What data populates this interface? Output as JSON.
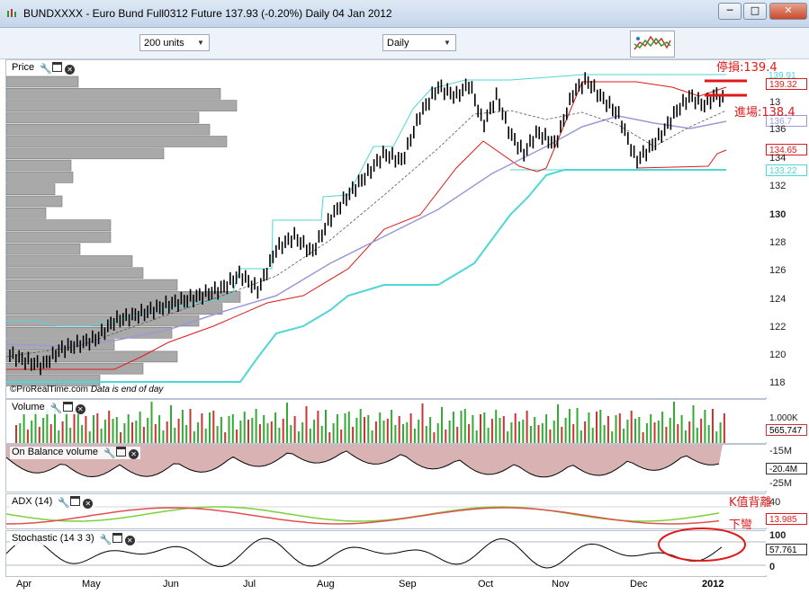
{
  "window": {
    "title": "BUNDXXXX - Euro Bund Full0312 Future   137.93 (-0.20%)   Daily  04 Jan 2012",
    "minimize": "─",
    "maximize": "□",
    "close": "✕"
  },
  "toolbar": {
    "units_select": "200 units",
    "period_select": "Daily"
  },
  "price_panel": {
    "label": "Price",
    "copyright": "©ProRealTime.com",
    "data_note": "Data is end of day",
    "ticks": [
      "136",
      "134",
      "132",
      "130",
      "128",
      "126",
      "124",
      "122",
      "120",
      "118"
    ],
    "tags": [
      {
        "text": "139.91",
        "color": "#4fd6d6"
      },
      {
        "text": "139.32",
        "color": "#e01919"
      },
      {
        "text": "136.7",
        "color": "#9a9ad6"
      },
      {
        "text": "134.65",
        "color": "#e01919"
      },
      {
        "text": "133.22",
        "color": "#4fd6d6"
      }
    ],
    "price_partial": "13"
  },
  "volume_panel": {
    "label": "Volume",
    "ticks": [
      "1.000K"
    ],
    "tag": "565,747"
  },
  "obv_panel": {
    "label": "On Balance volume",
    "ticks": [
      "-15M",
      "-25M"
    ],
    "tag": "-20.4M"
  },
  "adx_panel": {
    "label": "ADX (14)",
    "ticks": [
      "40"
    ],
    "tag": "13.985"
  },
  "stoch_panel": {
    "label": "Stochastic (14 3 3)",
    "ticks": [
      "100",
      "0"
    ],
    "tag": "57.761"
  },
  "months": [
    "Apr",
    "May",
    "Jun",
    "Jul",
    "Aug",
    "Sep",
    "Oct",
    "Nov",
    "Dec",
    "2012"
  ],
  "annotations": {
    "stop": "停損:139.4",
    "entry": "進場:138.4",
    "k_divergence": "K值背離",
    "k_bend": "下彎"
  },
  "colors": {
    "channel": "#4fd6d6",
    "stop_line": "#e01919",
    "ma_long": "#9a9ad6",
    "bars": "#000000",
    "vol_up": "#33aa33",
    "vol_down": "#cc3333",
    "obv_fill": "#d9b3b3"
  }
}
